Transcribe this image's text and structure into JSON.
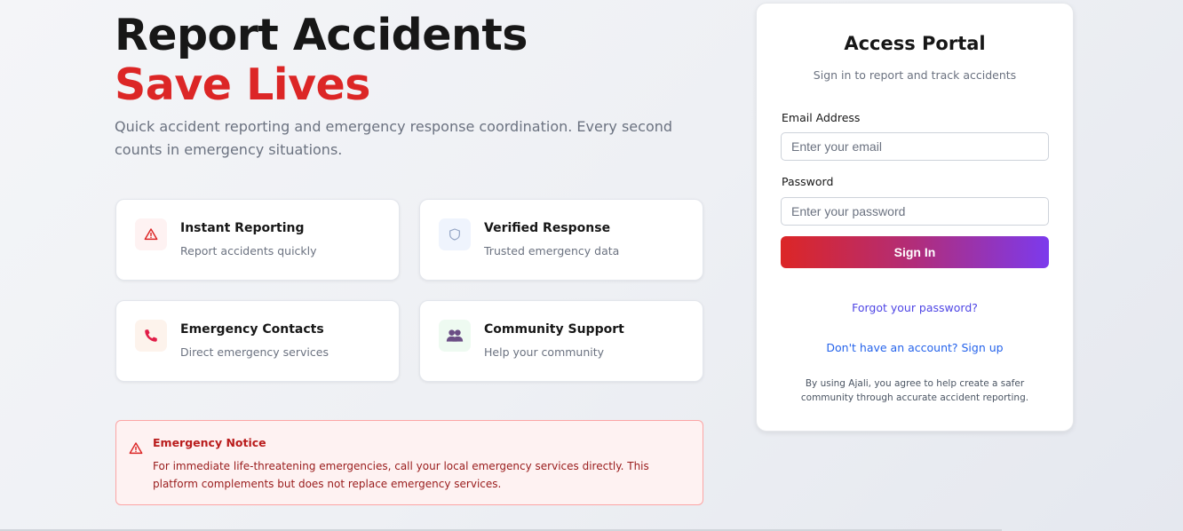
{
  "hero": {
    "title": "Report Accidents",
    "accent": "Save Lives",
    "subtitle": "Quick accident reporting and emergency response coordination. Every second counts in emergency situations."
  },
  "features": [
    {
      "title": "Instant Reporting",
      "desc": "Report accidents quickly",
      "icon": "warning-triangle-icon",
      "icon_color": "#dc2626",
      "icon_bg": "#fef2f2"
    },
    {
      "title": "Verified Response",
      "desc": "Trusted emergency data",
      "icon": "shield-icon",
      "icon_color": "#93a4c4",
      "icon_bg": "#eff4fd"
    },
    {
      "title": "Emergency Contacts",
      "desc": "Direct emergency services",
      "icon": "phone-icon",
      "icon_color": "#e11d48",
      "icon_bg": "#fdf3ec"
    },
    {
      "title": "Community Support",
      "desc": "Help your community",
      "icon": "users-icon",
      "icon_color": "#6b4e85",
      "icon_bg": "#eefaf1"
    }
  ],
  "notice": {
    "title": "Emergency Notice",
    "text": "For immediate life-threatening emergencies, call your local emergency services directly. This platform complements but does not replace emergency services."
  },
  "portal": {
    "title": "Access Portal",
    "subtitle": "Sign in to report and track accidents",
    "email_label": "Email Address",
    "email_placeholder": "Enter your email",
    "email_value": "",
    "password_label": "Password",
    "password_placeholder": "Enter your password",
    "password_value": "",
    "signin_label": "Sign In",
    "forgot_link": "Forgot your password?",
    "signup_link": "Don't have an account? Sign up",
    "terms": "By using Ajali, you agree to help create a safer community through accurate accident reporting."
  },
  "colors": {
    "accent_red": "#dc2626",
    "button_gradient_start": "#dc2626",
    "button_gradient_end": "#7c3aed",
    "link": "#4f46e5"
  }
}
